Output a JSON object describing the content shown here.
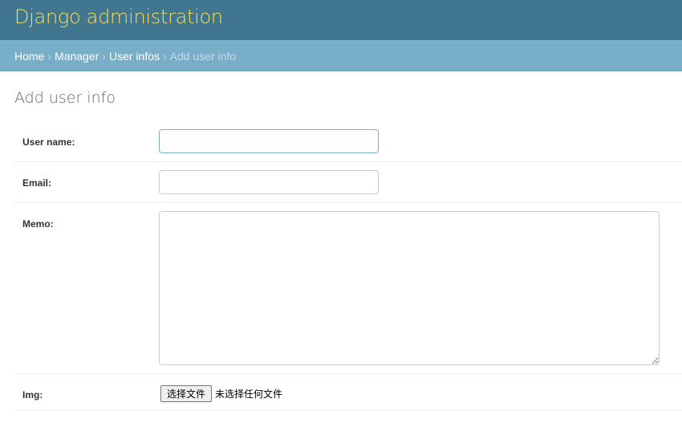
{
  "header": {
    "site_title": "Django administration"
  },
  "breadcrumbs": {
    "home": "Home",
    "app": "Manager",
    "model": "User infos",
    "current": "Add user info",
    "separator": "›"
  },
  "page": {
    "title": "Add user info"
  },
  "form": {
    "user_name": {
      "label": "User name:",
      "value": ""
    },
    "email": {
      "label": "Email:",
      "value": ""
    },
    "memo": {
      "label": "Memo:",
      "value": ""
    },
    "img": {
      "label": "Img:",
      "button_label": "选择文件",
      "status": "未选择任何文件"
    }
  }
}
